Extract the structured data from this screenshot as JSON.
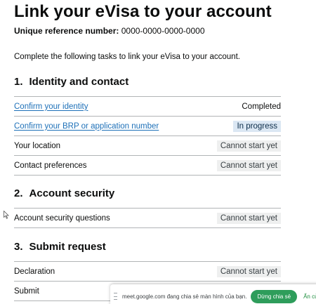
{
  "page": {
    "title": "Link your eVisa to your account",
    "reference_label": "Unique reference number:",
    "reference_value": "0000-0000-0000-0000",
    "intro": "Complete the following tasks to link your eVisa to your account."
  },
  "sections": [
    {
      "number": "1.",
      "title": "Identity and contact",
      "tasks": [
        {
          "name": "Confirm your identity",
          "status": "Completed",
          "is_link": true,
          "status_type": "completed"
        },
        {
          "name": "Confirm your BRP or application number",
          "status": "In progress",
          "is_link": true,
          "status_type": "in-progress"
        },
        {
          "name": "Your location",
          "status": "Cannot start yet",
          "is_link": false,
          "status_type": "cannot-start"
        },
        {
          "name": "Contact preferences",
          "status": "Cannot start yet",
          "is_link": false,
          "status_type": "cannot-start"
        }
      ]
    },
    {
      "number": "2.",
      "title": "Account security",
      "tasks": [
        {
          "name": "Account security questions",
          "status": "Cannot start yet",
          "is_link": false,
          "status_type": "cannot-start"
        }
      ]
    },
    {
      "number": "3.",
      "title": "Submit request",
      "tasks": [
        {
          "name": "Declaration",
          "status": "Cannot start yet",
          "is_link": false,
          "status_type": "cannot-start"
        },
        {
          "name": "Submit",
          "status": "",
          "is_link": false,
          "status_type": "cannot-start"
        }
      ]
    }
  ],
  "screen_share_bar": {
    "message": "meet.google.com đang chia sẻ màn hình của bạn.",
    "stop_label": "Dừng chia sẻ",
    "hide_label": "Ẩn cửa sổ"
  },
  "colors": {
    "link": "#1d70b8",
    "in_progress_bg": "#dbe7f3",
    "cannot_start_bg": "#eeefef",
    "stop_button": "#2e9d5b"
  }
}
